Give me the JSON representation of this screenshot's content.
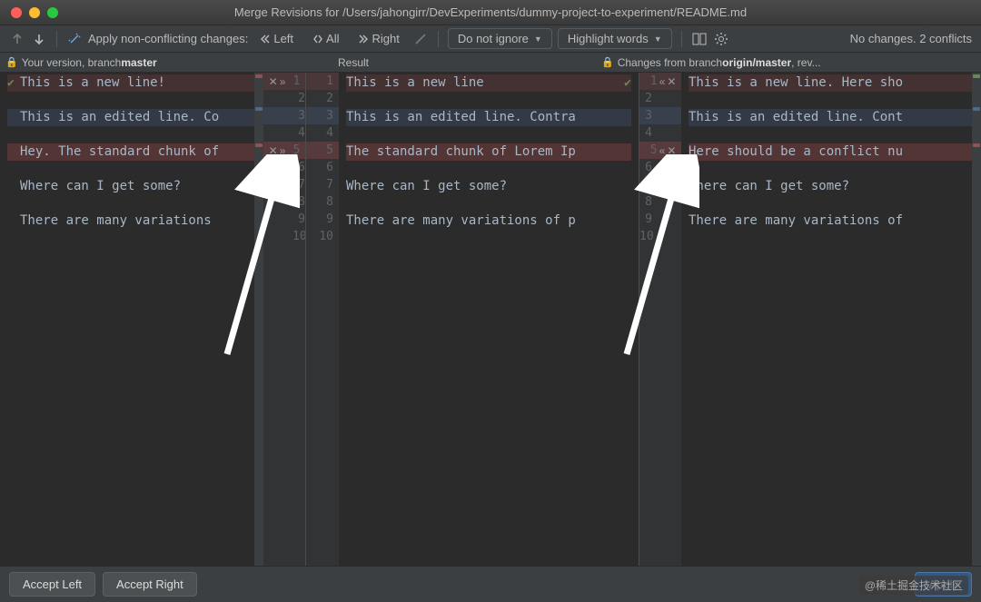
{
  "window": {
    "title": "Merge Revisions for /Users/jahongirr/DevExperiments/dummy-project-to-experiment/README.md"
  },
  "toolbar": {
    "apply_label": "Apply non-conflicting changes:",
    "left_label": "Left",
    "all_label": "All",
    "right_label": "Right",
    "dropdown_ignore": "Do not ignore",
    "dropdown_highlight": "Highlight words",
    "status": "No changes. 2 conflicts"
  },
  "headers": {
    "left_prefix": "Your version, branch ",
    "left_branch": "master",
    "center": "Result",
    "right_prefix": "Changes from branch ",
    "right_branch": "origin/master",
    "right_suffix": ", rev..."
  },
  "left_lines": [
    "This is a new line!",
    "",
    "This is an edited line. Co",
    "",
    "Hey. The standard chunk of",
    "",
    "Where can I get some?",
    "",
    "There are many variations"
  ],
  "center_lines": [
    "This is a new line",
    "",
    "This is an edited line. Contra",
    "",
    "The standard chunk of Lorem Ip",
    "",
    "Where can I get some?",
    "",
    "There are many variations of p"
  ],
  "right_lines": [
    "This is a new line. Here sho",
    "",
    "This is an edited line. Cont",
    "",
    "Here should be a conflict nu",
    "",
    "Where can I get some?",
    "",
    "There are many variations of"
  ],
  "gutter_left": [
    "1",
    "2",
    "3",
    "4",
    "5",
    "6",
    "7",
    "8",
    "9",
    "10"
  ],
  "gutter_center": [
    "1",
    "2",
    "3",
    "4",
    "5",
    "6",
    "7",
    "8",
    "9",
    "10"
  ],
  "gutter_right": [
    "1",
    "2",
    "3",
    "4",
    "5",
    "6",
    "7",
    "8",
    "9",
    "10"
  ],
  "buttons": {
    "accept_left": "Accept Left",
    "accept_right": "Accept Right",
    "apply": "Apply"
  },
  "watermark": "@稀土掘金技术社区",
  "colors": {
    "conflict": "#8f5252",
    "modified": "#4a6a8a",
    "accept": "#6a8759"
  }
}
